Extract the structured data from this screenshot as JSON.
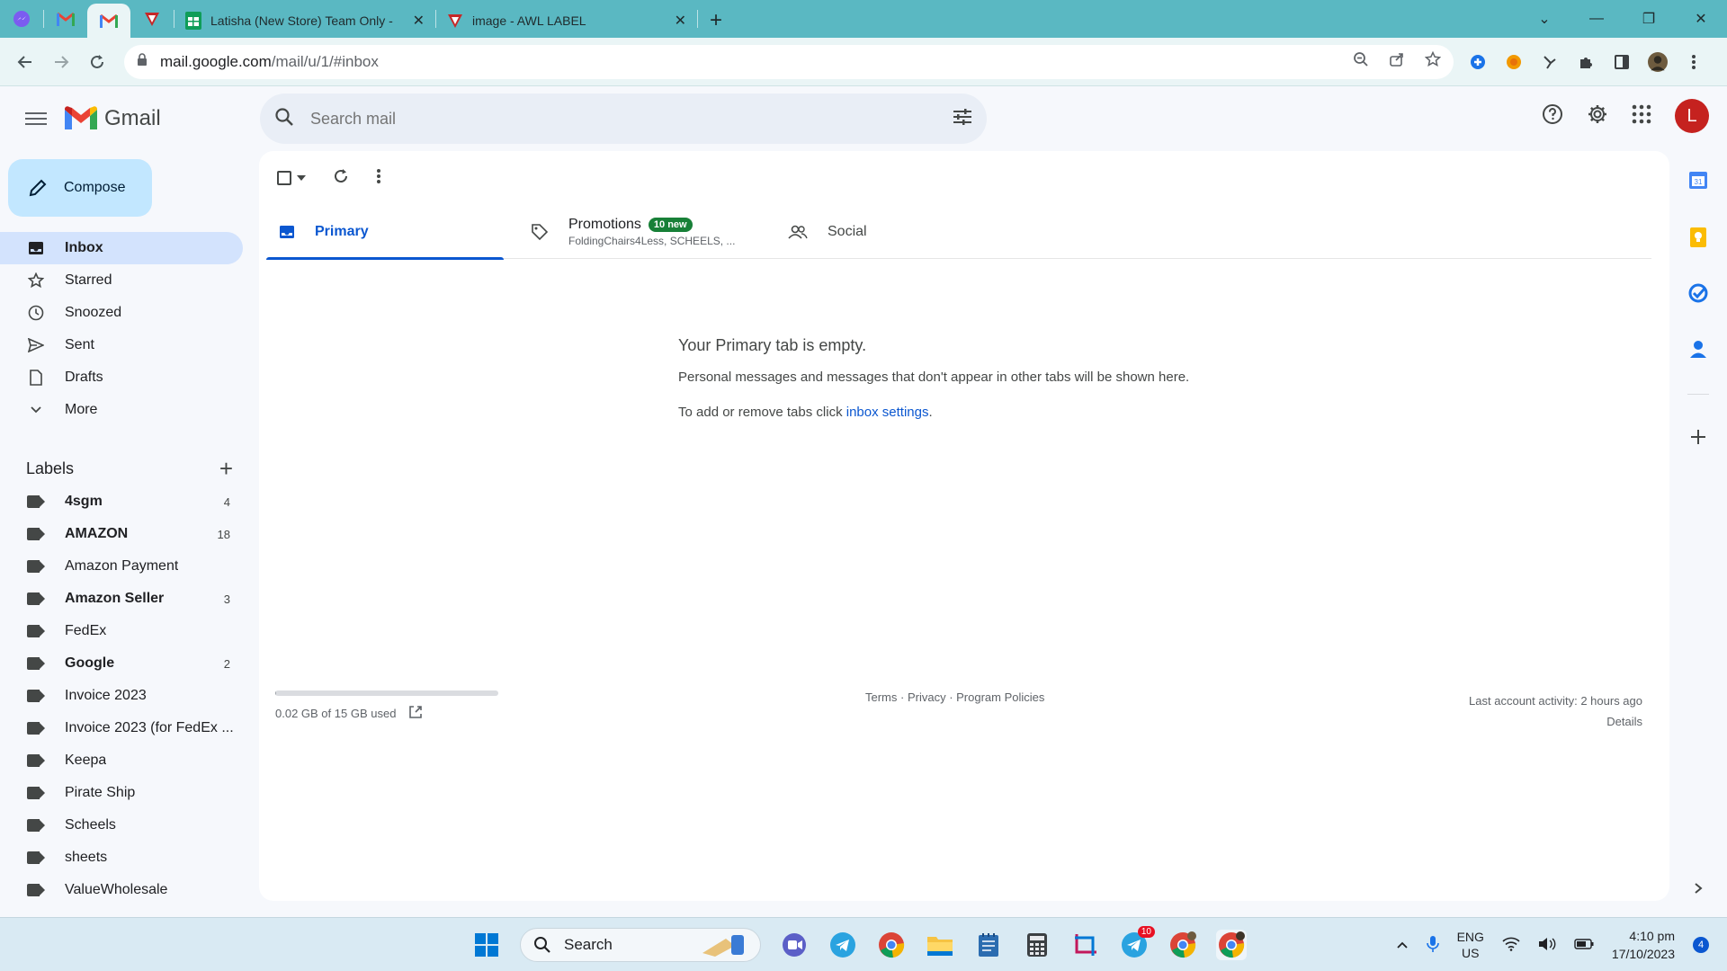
{
  "browser": {
    "tabs": [
      {
        "title": "Latisha (New Store) Team Only -"
      },
      {
        "title": "image - AWL LABEL"
      }
    ],
    "url_host": "mail.google.com",
    "url_path": "/mail/u/1/#inbox"
  },
  "gmail": {
    "logo_text": "Gmail",
    "search_placeholder": "Search mail",
    "avatar_letter": "L",
    "compose_label": "Compose",
    "nav": [
      {
        "label": "Inbox",
        "icon": "inbox-icon"
      },
      {
        "label": "Starred",
        "icon": "star-icon"
      },
      {
        "label": "Snoozed",
        "icon": "clock-icon"
      },
      {
        "label": "Sent",
        "icon": "send-icon"
      },
      {
        "label": "Drafts",
        "icon": "draft-icon"
      },
      {
        "label": "More",
        "icon": "chevron-down-icon"
      }
    ],
    "labels_title": "Labels",
    "labels": [
      {
        "name": "4sgm",
        "count": "4",
        "bold": true
      },
      {
        "name": "AMAZON",
        "count": "18",
        "bold": true
      },
      {
        "name": "Amazon Payment",
        "count": "",
        "bold": false
      },
      {
        "name": "Amazon Seller",
        "count": "3",
        "bold": true
      },
      {
        "name": "FedEx",
        "count": "",
        "bold": false
      },
      {
        "name": "Google",
        "count": "2",
        "bold": true
      },
      {
        "name": "Invoice 2023",
        "count": "",
        "bold": false
      },
      {
        "name": "Invoice 2023 (for FedEx ...",
        "count": "",
        "bold": false
      },
      {
        "name": "Keepa",
        "count": "",
        "bold": false
      },
      {
        "name": "Pirate Ship",
        "count": "",
        "bold": false
      },
      {
        "name": "Scheels",
        "count": "",
        "bold": false
      },
      {
        "name": "sheets",
        "count": "",
        "bold": false
      },
      {
        "name": "ValueWholesale",
        "count": "",
        "bold": false
      }
    ],
    "tabs": {
      "primary": "Primary",
      "promotions": "Promotions",
      "promotions_badge": "10 new",
      "promotions_senders": "FoldingChairs4Less, SCHEELS, ...",
      "social": "Social"
    },
    "empty": {
      "title": "Your Primary tab is empty.",
      "line1": "Personal messages and messages that don't appear in other tabs will be shown here.",
      "line2_prefix": "To add or remove tabs click ",
      "line2_link": "inbox settings",
      "line2_suffix": "."
    },
    "footer": {
      "storage_text": "0.02 GB of 15 GB used",
      "storage_fraction": 0.0013,
      "terms": "Terms",
      "privacy": "Privacy",
      "policies": "Program Policies",
      "sep": " · ",
      "activity": "Last account activity: 2 hours ago",
      "details": "Details"
    }
  },
  "taskbar": {
    "search_label": "Search",
    "telegram_badge": "10",
    "lang_top": "ENG",
    "lang_bottom": "US",
    "time": "4:10 pm",
    "date": "17/10/2023",
    "notification_count": "4"
  },
  "colors": {
    "tabstrip": "#5ab8c2",
    "compose": "#c2e7ff",
    "active_nav": "#d3e3fd",
    "accent": "#0b57d0",
    "badge_green": "#188038",
    "avatar": "#c5221f"
  }
}
